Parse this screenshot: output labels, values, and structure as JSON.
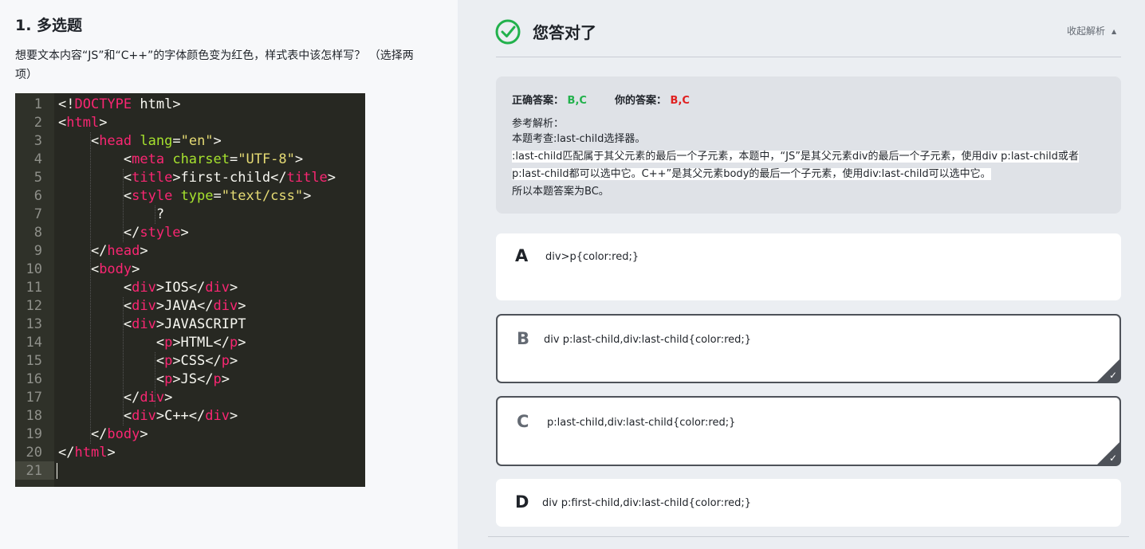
{
  "question": {
    "title": "1. 多选题",
    "description": "想要文本内容“JS”和“C++”的字体颜色变为红色，样式表中该怎样写？ （选择两项）"
  },
  "code": {
    "lines": [
      {
        "n": "1",
        "tokens": [
          [
            "p",
            "<!"
          ],
          [
            "t",
            "DOCTYPE"
          ],
          [
            "p",
            " html>"
          ]
        ]
      },
      {
        "n": "2",
        "tokens": [
          [
            "p",
            "<"
          ],
          [
            "t",
            "html"
          ],
          [
            "p",
            ">"
          ]
        ]
      },
      {
        "n": "3",
        "tokens": [
          [
            "p",
            "    <"
          ],
          [
            "t",
            "head"
          ],
          [
            "p",
            " "
          ],
          [
            "a",
            "lang"
          ],
          [
            "p",
            "="
          ],
          [
            "s",
            "\"en\""
          ],
          [
            "p",
            ">"
          ]
        ]
      },
      {
        "n": "4",
        "tokens": [
          [
            "p",
            "        <"
          ],
          [
            "t",
            "meta"
          ],
          [
            "p",
            " "
          ],
          [
            "a",
            "charset"
          ],
          [
            "p",
            "="
          ],
          [
            "s",
            "\"UTF-8\""
          ],
          [
            "p",
            ">"
          ]
        ]
      },
      {
        "n": "5",
        "tokens": [
          [
            "p",
            "        <"
          ],
          [
            "t",
            "title"
          ],
          [
            "p",
            ">first-child</"
          ],
          [
            "t",
            "title"
          ],
          [
            "p",
            ">"
          ]
        ]
      },
      {
        "n": "6",
        "tokens": [
          [
            "p",
            "        <"
          ],
          [
            "t",
            "style"
          ],
          [
            "p",
            " "
          ],
          [
            "a",
            "type"
          ],
          [
            "p",
            "="
          ],
          [
            "s",
            "\"text/css\""
          ],
          [
            "p",
            ">"
          ]
        ]
      },
      {
        "n": "7",
        "tokens": [
          [
            "p",
            "            ?"
          ]
        ]
      },
      {
        "n": "8",
        "tokens": [
          [
            "p",
            "        </"
          ],
          [
            "t",
            "style"
          ],
          [
            "p",
            ">"
          ]
        ]
      },
      {
        "n": "9",
        "tokens": [
          [
            "p",
            "    </"
          ],
          [
            "t",
            "head"
          ],
          [
            "p",
            ">"
          ]
        ]
      },
      {
        "n": "10",
        "tokens": [
          [
            "p",
            "    <"
          ],
          [
            "t",
            "body"
          ],
          [
            "p",
            ">"
          ]
        ]
      },
      {
        "n": "11",
        "tokens": [
          [
            "p",
            "        <"
          ],
          [
            "t",
            "div"
          ],
          [
            "p",
            ">IOS</"
          ],
          [
            "t",
            "div"
          ],
          [
            "p",
            ">"
          ]
        ]
      },
      {
        "n": "12",
        "tokens": [
          [
            "p",
            "        <"
          ],
          [
            "t",
            "div"
          ],
          [
            "p",
            ">JAVA</"
          ],
          [
            "t",
            "div"
          ],
          [
            "p",
            ">"
          ]
        ]
      },
      {
        "n": "13",
        "tokens": [
          [
            "p",
            "        <"
          ],
          [
            "t",
            "div"
          ],
          [
            "p",
            ">JAVASCRIPT"
          ]
        ]
      },
      {
        "n": "14",
        "tokens": [
          [
            "p",
            "            <"
          ],
          [
            "t",
            "p"
          ],
          [
            "p",
            ">HTML</"
          ],
          [
            "t",
            "p"
          ],
          [
            "p",
            ">"
          ]
        ]
      },
      {
        "n": "15",
        "tokens": [
          [
            "p",
            "            <"
          ],
          [
            "t",
            "p"
          ],
          [
            "p",
            ">CSS</"
          ],
          [
            "t",
            "p"
          ],
          [
            "p",
            ">"
          ]
        ]
      },
      {
        "n": "16",
        "tokens": [
          [
            "p",
            "            <"
          ],
          [
            "t",
            "p"
          ],
          [
            "p",
            ">JS</"
          ],
          [
            "t",
            "p"
          ],
          [
            "p",
            ">"
          ]
        ]
      },
      {
        "n": "17",
        "tokens": [
          [
            "p",
            "        </"
          ],
          [
            "t",
            "div"
          ],
          [
            "p",
            ">"
          ]
        ]
      },
      {
        "n": "18",
        "tokens": [
          [
            "p",
            "        <"
          ],
          [
            "t",
            "div"
          ],
          [
            "p",
            ">C++</"
          ],
          [
            "t",
            "div"
          ],
          [
            "p",
            ">"
          ]
        ]
      },
      {
        "n": "19",
        "tokens": [
          [
            "p",
            "    </"
          ],
          [
            "t",
            "body"
          ],
          [
            "p",
            ">"
          ]
        ]
      },
      {
        "n": "20",
        "tokens": [
          [
            "p",
            "</"
          ],
          [
            "t",
            "html"
          ],
          [
            "p",
            ">"
          ]
        ]
      },
      {
        "n": "21",
        "tokens": []
      }
    ],
    "colors": {
      "tag": "#f92672",
      "attr": "#a6e22e",
      "string": "#e6db74",
      "plain": "#f8f8f2",
      "background": "#272822"
    }
  },
  "result": {
    "title": "您答对了",
    "collapse_label": "收起解析",
    "correct_label": "正确答案：",
    "correct_value": "B,C",
    "yours_label": "你的答案：",
    "yours_value": "B,C",
    "analysis_label": "参考解析：",
    "analysis_lines": [
      "本题考查:last-child选择器。",
      ":last-child匹配属于其父元素的最后一个子元素，本题中，“JS”是其父元素div的最后一个子元素，使用div p:last-child或者 p:last-child都可以选中它。C++”是其父元素body的最后一个子元素，使用div:last-child可以选中它。",
      "所以本题答案为BC。"
    ],
    "accent_green": "#22b14c",
    "accent_red": "#e02020"
  },
  "options": [
    {
      "letter": "A",
      "text": "div>p{color:red;}",
      "selected": false
    },
    {
      "letter": "B",
      "text": "div p:last-child,div:last-child{color:red;}",
      "selected": true
    },
    {
      "letter": "C",
      "text": "p:last-child,div:last-child{color:red;}",
      "selected": true
    },
    {
      "letter": "D",
      "text": "div p:first-child,div:last-child{color:red;}",
      "selected": false
    }
  ]
}
